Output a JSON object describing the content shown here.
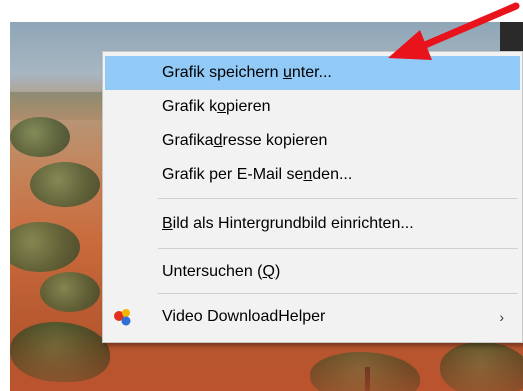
{
  "menu": {
    "items": [
      {
        "pre": "Grafik speichern ",
        "key": "u",
        "post": "nter...",
        "highlighted": true
      },
      {
        "pre": "Grafik k",
        "key": "o",
        "post": "pieren",
        "highlighted": false
      },
      {
        "pre": "Grafika",
        "key": "d",
        "post": "resse kopieren",
        "highlighted": false
      },
      {
        "pre": "Grafik per E-Mail se",
        "key": "n",
        "post": "den...",
        "highlighted": false
      },
      {
        "pre": "",
        "key": "B",
        "post": "ild als Hintergrundbild einrichten...",
        "highlighted": false
      },
      {
        "pre": "Untersuchen (",
        "key": "Q",
        "post": ")",
        "highlighted": false
      },
      {
        "label": "Video DownloadHelper",
        "submenu_glyph": "›",
        "icon": "video-downloadhelper-icon"
      }
    ]
  },
  "annotation": {
    "arrow_color": "#e8131b",
    "points_to": "Grafik speichern unter..."
  },
  "colors": {
    "highlight": "#91c9f7",
    "menu_bg": "#f2f2f2"
  }
}
